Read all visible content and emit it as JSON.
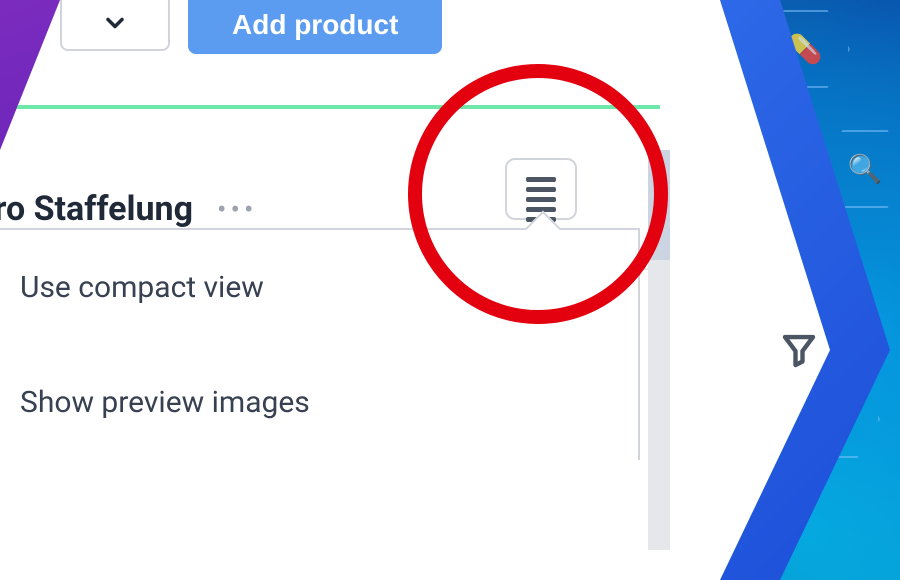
{
  "toolbar": {
    "add_product_label": "Add product"
  },
  "column": {
    "title": "ro Staffelung",
    "ellipsis": "•••"
  },
  "view_menu": {
    "items": [
      {
        "label": "Use compact view"
      },
      {
        "label": "Show preview images"
      }
    ]
  },
  "icons": {
    "chevron_down": "chevron-down",
    "hamburger": "menu",
    "filter": "filter",
    "pill": "pill",
    "search": "search"
  },
  "highlight": {
    "target": "view-options-button",
    "color": "#e3000f"
  }
}
